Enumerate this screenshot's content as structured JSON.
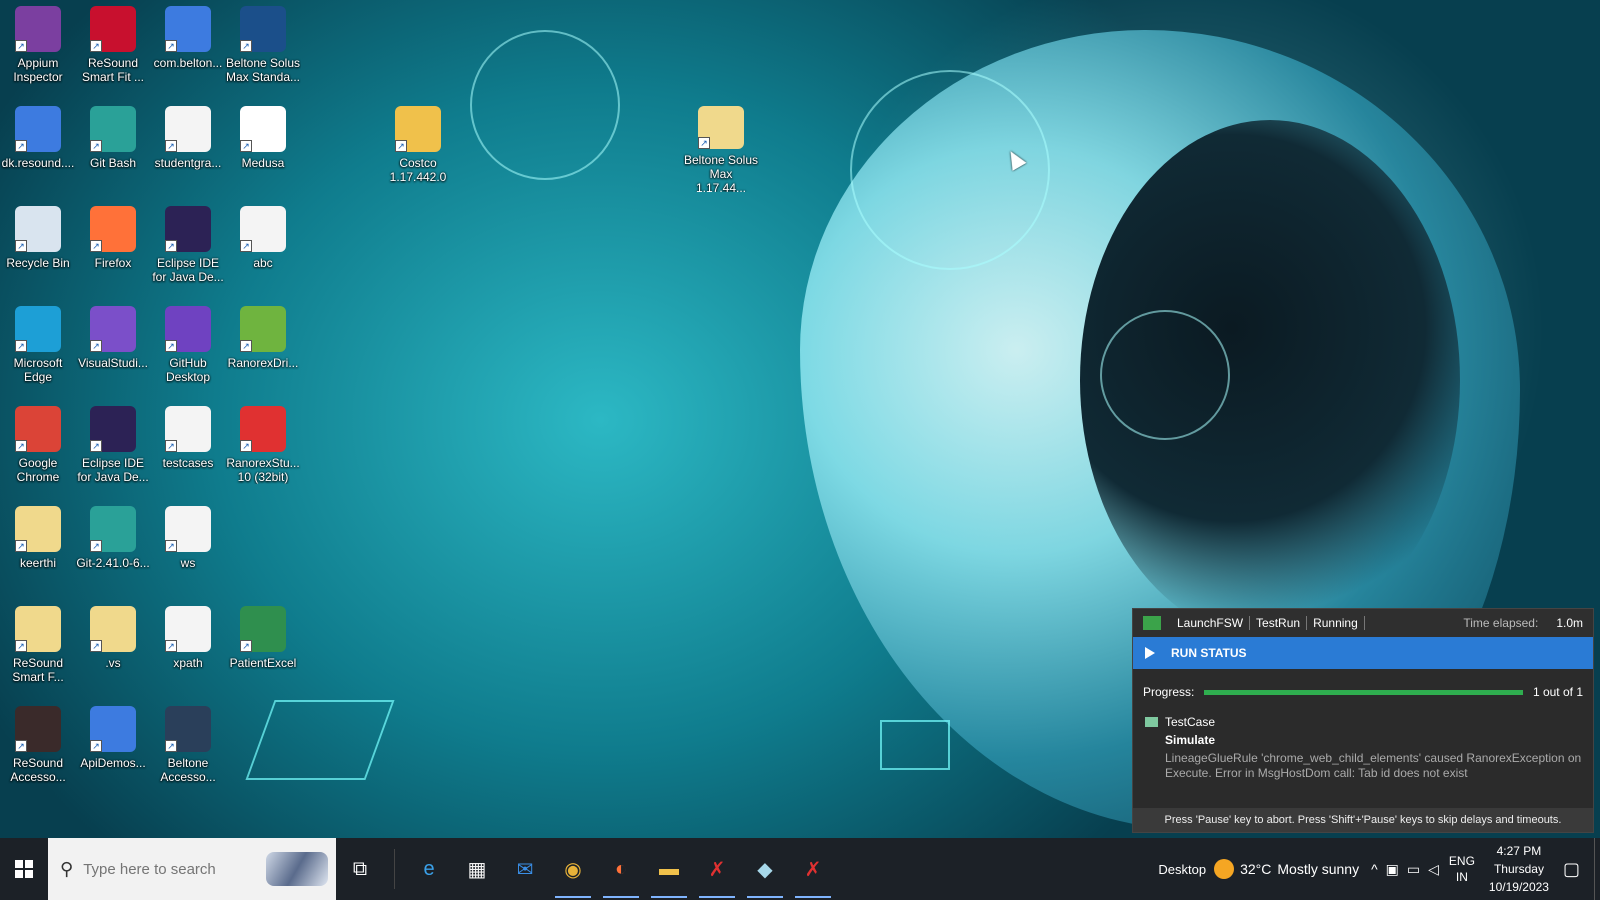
{
  "desktop": {
    "icons": [
      {
        "label": "Appium Inspector",
        "icon": "appium-icon",
        "color": "#7b3fa0"
      },
      {
        "label": "ReSound Smart Fit ...",
        "icon": "resound-smartfit-icon",
        "color": "#c8102e"
      },
      {
        "label": "com.belton...",
        "icon": "apk-icon",
        "color": "#3d7be0"
      },
      {
        "label": "Beltone Solus Max Standa...",
        "icon": "beltone-icon",
        "color": "#1b4f8a"
      },
      {
        "label": "dk.resound....",
        "icon": "apk-icon",
        "color": "#3d7be0"
      },
      {
        "label": "Git Bash",
        "icon": "git-bash-icon",
        "color": "#2aa198"
      },
      {
        "label": "studentgra...",
        "icon": "text-file-icon",
        "color": "#f4f4f4"
      },
      {
        "label": "Medusa",
        "icon": "file-icon",
        "color": "#ffffff"
      },
      {
        "label": "Costco 1.17.442.0",
        "icon": "zip-folder-icon",
        "color": "#f0c14b"
      },
      {
        "label": "Beltone Solus Max 1.17.44...",
        "icon": "folder-icon",
        "color": "#f0d98c"
      },
      {
        "label": "Recycle Bin",
        "icon": "recycle-bin-icon",
        "color": "#d9e4ef"
      },
      {
        "label": "Firefox",
        "icon": "firefox-icon",
        "color": "#ff7139"
      },
      {
        "label": "Eclipse IDE for Java De...",
        "icon": "eclipse-icon",
        "color": "#2c2255"
      },
      {
        "label": "abc",
        "icon": "html-file-icon",
        "color": "#f4f4f4"
      },
      {
        "label": "Microsoft Edge",
        "icon": "edge-icon",
        "color": "#1d9fd6"
      },
      {
        "label": "VisualStudi...",
        "icon": "visual-studio-icon",
        "color": "#7b4fc9"
      },
      {
        "label": "GitHub Desktop",
        "icon": "github-desktop-icon",
        "color": "#6f42c1"
      },
      {
        "label": "RanorexDri...",
        "icon": "ranorex-driver-icon",
        "color": "#6fb43f"
      },
      {
        "label": "Google Chrome",
        "icon": "chrome-icon",
        "color": "#db4437"
      },
      {
        "label": "Eclipse IDE for Java De...",
        "icon": "eclipse-icon",
        "color": "#2c2255"
      },
      {
        "label": "testcases",
        "icon": "text-file-icon",
        "color": "#f4f4f4"
      },
      {
        "label": "RanorexStu... 10 (32bit)",
        "icon": "ranorex-studio-icon",
        "color": "#e03131"
      },
      {
        "label": "keerthi",
        "icon": "folder-icon",
        "color": "#f0d98c"
      },
      {
        "label": "Git-2.41.0-6...",
        "icon": "git-installer-icon",
        "color": "#2aa198"
      },
      {
        "label": "ws",
        "icon": "text-file-icon",
        "color": "#f4f4f4"
      },
      {
        "label": "ReSound Smart F...",
        "icon": "folder-icon",
        "color": "#f0d98c"
      },
      {
        "label": ".vs",
        "icon": "folder-icon",
        "color": "#f0d98c"
      },
      {
        "label": "xpath",
        "icon": "text-file-icon",
        "color": "#f4f4f4"
      },
      {
        "label": "PatientExcel",
        "icon": "patient-excel-icon",
        "color": "#2f8f4e"
      },
      {
        "label": "ReSound Accesso...",
        "icon": "resound-accessory-icon",
        "color": "#3a2a2a"
      },
      {
        "label": "ApiDemos...",
        "icon": "apk-icon",
        "color": "#3d7be0"
      },
      {
        "label": "Beltone Accesso...",
        "icon": "beltone-accessory-icon",
        "color": "#2a3f5a"
      }
    ]
  },
  "run_status": {
    "module": "LaunchFSW",
    "run": "TestRun",
    "state": "Running",
    "elapsed_label": "Time elapsed:",
    "elapsed_value": "1.0m",
    "header": "RUN STATUS",
    "progress_label": "Progress:",
    "progress_fraction": 1.0,
    "progress_text": "1 out of 1",
    "testcase_label": "TestCase",
    "testcase_name": "Simulate",
    "message": "LineageGlueRule 'chrome_web_child_elements' caused RanorexException on Execute. Error in MsgHostDom call: Tab id does not exist",
    "footer": "Press 'Pause' key to abort. Press 'Shift'+'Pause' keys to skip delays and timeouts.",
    "accent_color": "#2a7bd5",
    "progress_color": "#2fae4f"
  },
  "taskbar": {
    "search_placeholder": "Type here to search",
    "pinned": [
      {
        "name": "edge",
        "glyph": "e",
        "color": "#3aa0e8"
      },
      {
        "name": "microsoft-store",
        "glyph": "▦",
        "color": "#f2f2f2"
      },
      {
        "name": "mail",
        "glyph": "✉",
        "color": "#3a8ee6"
      },
      {
        "name": "chrome",
        "glyph": "◉",
        "color": "#e8b339"
      },
      {
        "name": "firefox",
        "glyph": "◐",
        "color": "#ff7139"
      },
      {
        "name": "file-explorer",
        "glyph": "▬",
        "color": "#f0c14b"
      },
      {
        "name": "ranorex-studio",
        "glyph": "✗",
        "color": "#e03131"
      },
      {
        "name": "ranorex-tool",
        "glyph": "◆",
        "color": "#a7d8ea"
      },
      {
        "name": "ranorex-spy",
        "glyph": "✗",
        "color": "#e03131"
      }
    ],
    "desktop_label": "Desktop",
    "weather_temp": "32°C",
    "weather_desc": "Mostly sunny",
    "lang_1": "ENG",
    "lang_2": "IN",
    "time": "4:27 PM",
    "day": "Thursday",
    "date": "10/19/2023"
  }
}
